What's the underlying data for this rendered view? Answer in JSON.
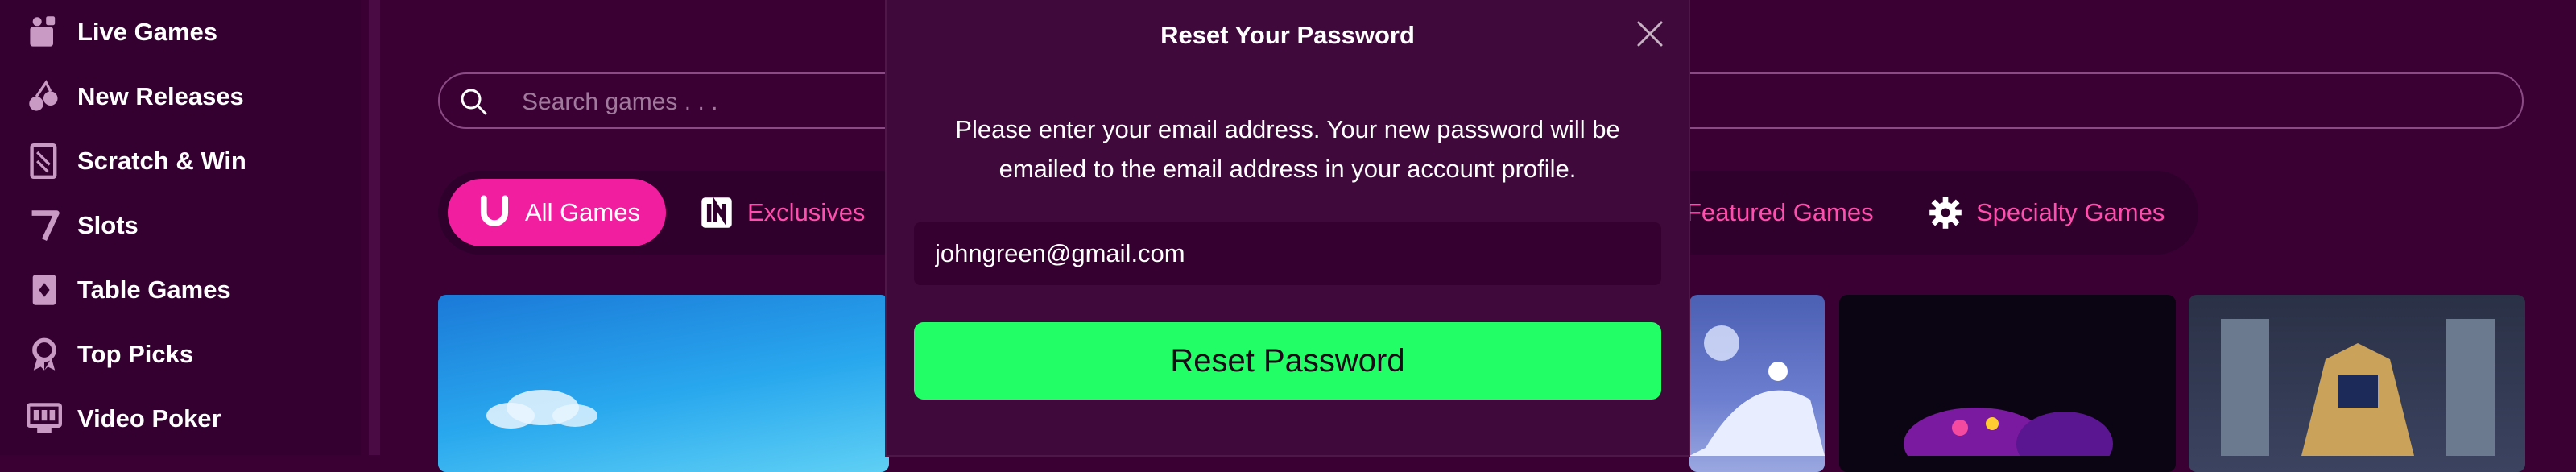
{
  "sidebar": {
    "items": [
      {
        "label": "Live Games",
        "icon": "live-games-icon"
      },
      {
        "label": "New Releases",
        "icon": "cherries-icon"
      },
      {
        "label": "Scratch & Win",
        "icon": "scratch-ticket-icon"
      },
      {
        "label": "Slots",
        "icon": "seven-icon"
      },
      {
        "label": "Table Games",
        "icon": "card-table-icon"
      },
      {
        "label": "Top Picks",
        "icon": "award-ribbon-icon"
      },
      {
        "label": "Video Poker",
        "icon": "video-poker-icon"
      }
    ]
  },
  "search": {
    "placeholder": "Search games . . ."
  },
  "categories": [
    {
      "label": "All Games",
      "icon": "horseshoe-icon",
      "active": true
    },
    {
      "label": "Exclusives",
      "icon": "exclusive-badge-icon",
      "active": false
    },
    {
      "label": "Featured Games",
      "icon": "",
      "active": false
    },
    {
      "label": "Specialty Games",
      "icon": "gear-icon",
      "active": false
    }
  ],
  "modal": {
    "title": "Reset Your Password",
    "message": "Please enter your email address. Your new password will be emailed to the email address in your account profile.",
    "email_value": "johngreen@gmail.com",
    "submit_label": "Reset Password"
  },
  "colors": {
    "background": "#3a0033",
    "accent_pink": "#f21ea0",
    "button_green": "#22ff66"
  }
}
